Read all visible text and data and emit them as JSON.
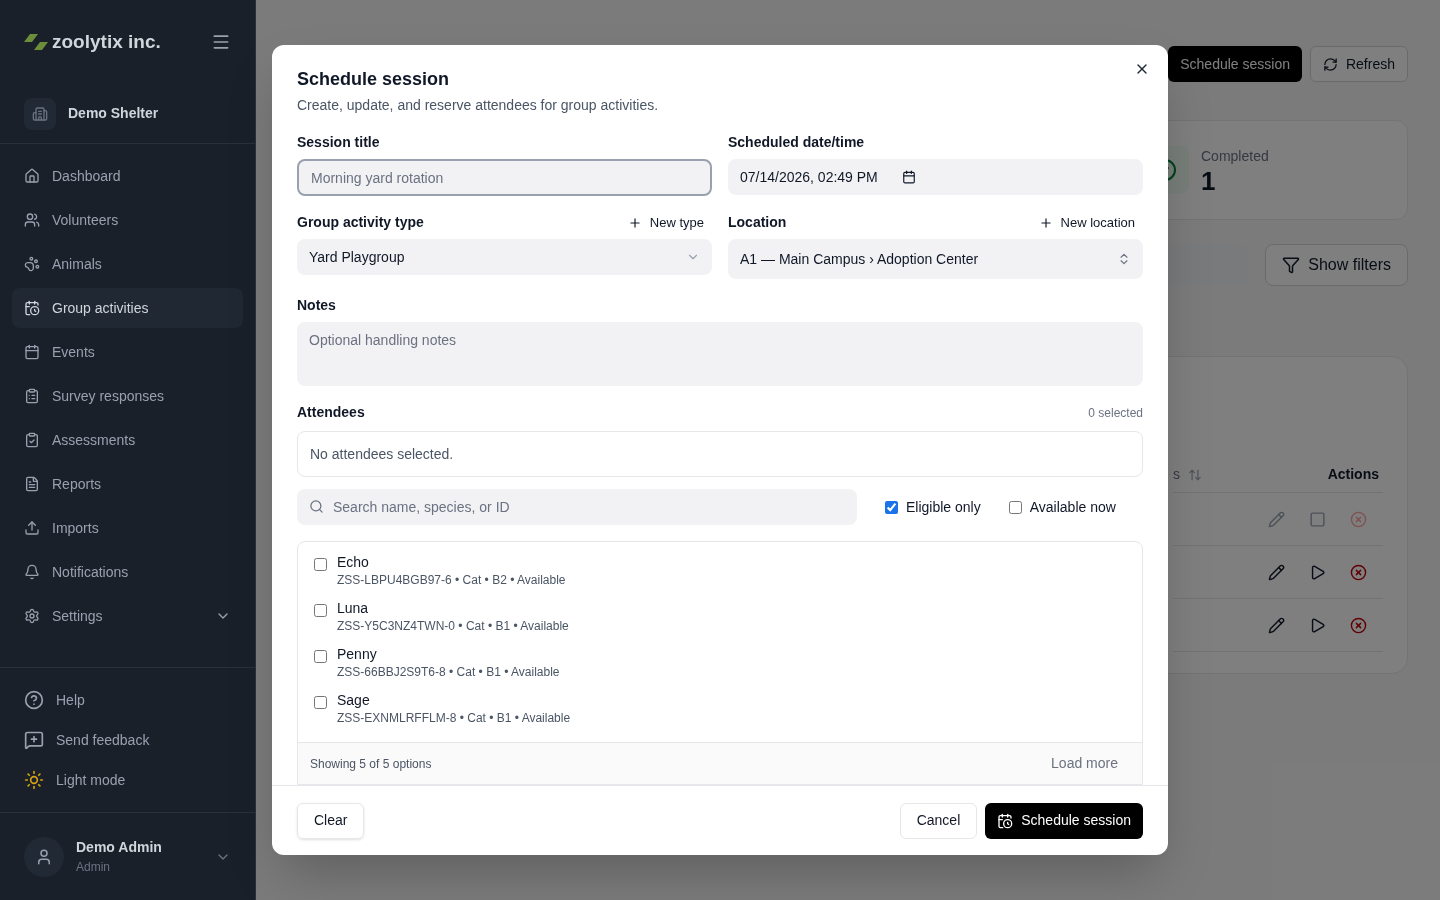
{
  "sidebar": {
    "brand": "zoolytix inc.",
    "organization": "Demo Shelter",
    "nav": [
      {
        "label": "Dashboard",
        "selected": false
      },
      {
        "label": "Volunteers",
        "selected": false
      },
      {
        "label": "Animals",
        "selected": false
      },
      {
        "label": "Group activities",
        "selected": true
      },
      {
        "label": "Events",
        "selected": false
      },
      {
        "label": "Survey responses",
        "selected": false
      },
      {
        "label": "Assessments",
        "selected": false
      },
      {
        "label": "Reports",
        "selected": false
      },
      {
        "label": "Imports",
        "selected": false
      },
      {
        "label": "Notifications",
        "selected": false
      },
      {
        "label": "Settings",
        "selected": false,
        "expanded": false
      }
    ],
    "footer_links": [
      "Help",
      "Send feedback",
      "Light mode"
    ],
    "user": {
      "name": "Demo Admin",
      "role": "Admin"
    }
  },
  "page": {
    "header_buttons": [
      "Schedule session",
      "Refresh"
    ],
    "stat": {
      "label": "Completed",
      "value": "1"
    },
    "filters_button": "Show filters",
    "table": {
      "columns": [
        "s",
        "Actions"
      ],
      "rows": [
        {
          "kind": "stop",
          "disabled": true
        },
        {
          "kind": "start",
          "disabled": false
        },
        {
          "kind": "start",
          "disabled": false
        }
      ]
    }
  },
  "dialog": {
    "title": "Schedule session",
    "subtitle": "Create, update, and reserve attendees for group activities.",
    "session_title": {
      "label": "Session title",
      "placeholder": "Morning yard rotation"
    },
    "datetime": {
      "label": "Scheduled date/time",
      "value": "07/14/2026, 02:49 PM"
    },
    "activity_type": {
      "label": "Group activity type",
      "action": "New type",
      "value": "Yard Playgroup"
    },
    "location": {
      "label": "Location",
      "action": "New location",
      "value": "A1 — Main Campus › Adoption Center"
    },
    "notes": {
      "label": "Notes",
      "placeholder": "Optional handling notes"
    },
    "attendees": {
      "label": "Attendees",
      "count": "0 selected",
      "empty": "No attendees selected.",
      "search_placeholder": "Search name, species, or ID",
      "filters": [
        {
          "label": "Eligible only",
          "checked": true
        },
        {
          "label": "Available now",
          "checked": false
        }
      ],
      "options": [
        {
          "name": "Echo",
          "detail": "ZSS-LBPU4BGB97-6 • Cat • B2 • Available",
          "checked": false
        },
        {
          "name": "Luna",
          "detail": "ZSS-Y5C3NZ4TWN-0 • Cat • B1 • Available",
          "checked": false
        },
        {
          "name": "Penny",
          "detail": "ZSS-66BBJ2S9T6-8 • Cat • B1 • Available",
          "checked": false
        },
        {
          "name": "Sage",
          "detail": "ZSS-EXNMLRFFLM-8 • Cat • B1 • Available",
          "checked": false
        }
      ],
      "showing": "Showing 5 of 5 options",
      "load_more": "Load more"
    },
    "buttons": {
      "clear": "Clear",
      "cancel": "Cancel",
      "submit": "Schedule session"
    }
  }
}
